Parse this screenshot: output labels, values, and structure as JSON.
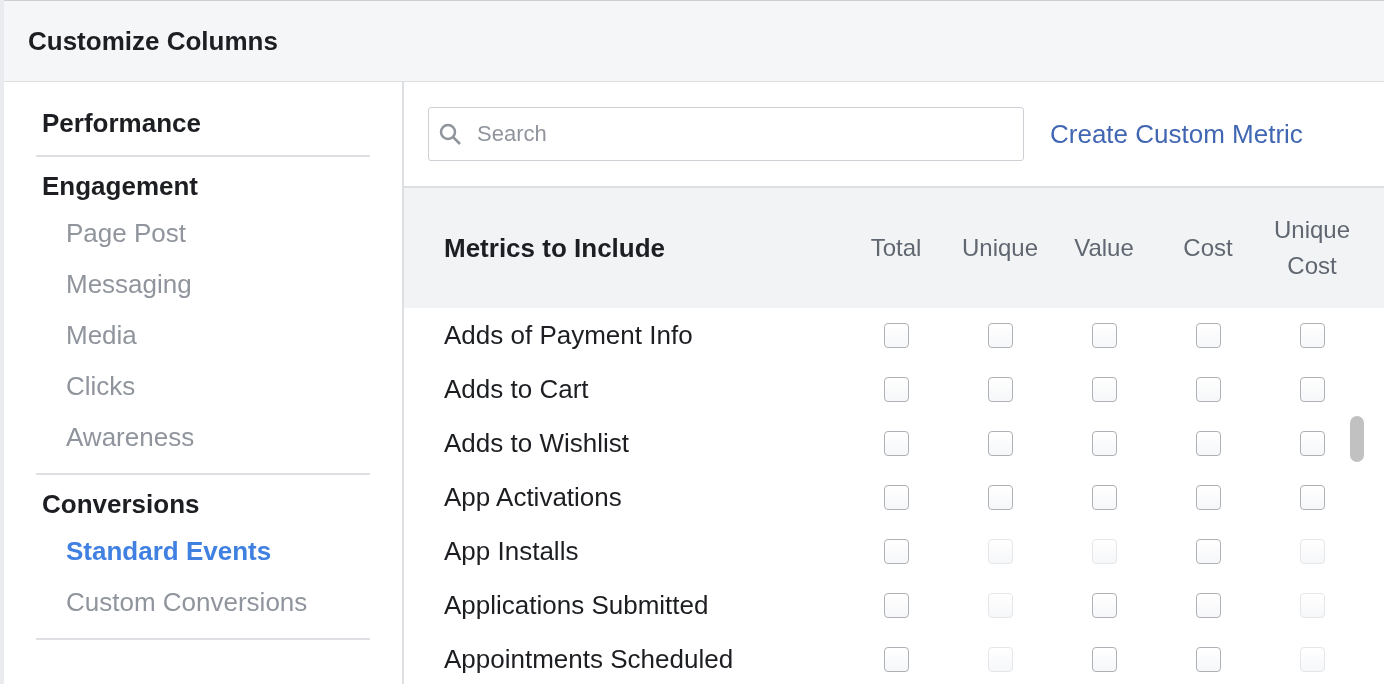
{
  "dialog": {
    "title": "Customize Columns"
  },
  "sidebar": {
    "groups": [
      {
        "title": "Performance"
      },
      {
        "title": "Engagement",
        "items": [
          {
            "label": "Page Post",
            "selected": false
          },
          {
            "label": "Messaging",
            "selected": false
          },
          {
            "label": "Media",
            "selected": false
          },
          {
            "label": "Clicks",
            "selected": false
          },
          {
            "label": "Awareness",
            "selected": false
          }
        ]
      },
      {
        "title": "Conversions",
        "items": [
          {
            "label": "Standard Events",
            "selected": true
          },
          {
            "label": "Custom Conversions",
            "selected": false
          }
        ]
      }
    ]
  },
  "search": {
    "placeholder": "Search"
  },
  "create_link": "Create Custom Metric",
  "table": {
    "title": "Metrics to Include",
    "columns": [
      "Total",
      "Unique",
      "Value",
      "Cost",
      "Unique Cost"
    ],
    "rows": [
      {
        "label": "Adds of Payment Info",
        "cells": [
          {
            "checked": false,
            "disabled": false
          },
          {
            "checked": false,
            "disabled": false
          },
          {
            "checked": false,
            "disabled": false
          },
          {
            "checked": false,
            "disabled": false
          },
          {
            "checked": false,
            "disabled": false
          }
        ]
      },
      {
        "label": "Adds to Cart",
        "cells": [
          {
            "checked": false,
            "disabled": false
          },
          {
            "checked": false,
            "disabled": false
          },
          {
            "checked": false,
            "disabled": false
          },
          {
            "checked": false,
            "disabled": false
          },
          {
            "checked": false,
            "disabled": false
          }
        ]
      },
      {
        "label": "Adds to Wishlist",
        "cells": [
          {
            "checked": false,
            "disabled": false
          },
          {
            "checked": false,
            "disabled": false
          },
          {
            "checked": false,
            "disabled": false
          },
          {
            "checked": false,
            "disabled": false
          },
          {
            "checked": false,
            "disabled": false
          }
        ]
      },
      {
        "label": "App Activations",
        "cells": [
          {
            "checked": false,
            "disabled": false
          },
          {
            "checked": false,
            "disabled": false
          },
          {
            "checked": false,
            "disabled": false
          },
          {
            "checked": false,
            "disabled": false
          },
          {
            "checked": false,
            "disabled": false
          }
        ]
      },
      {
        "label": "App Installs",
        "cells": [
          {
            "checked": false,
            "disabled": false
          },
          {
            "checked": false,
            "disabled": true
          },
          {
            "checked": false,
            "disabled": true
          },
          {
            "checked": false,
            "disabled": false
          },
          {
            "checked": false,
            "disabled": true
          }
        ]
      },
      {
        "label": "Applications Submitted",
        "cells": [
          {
            "checked": false,
            "disabled": false
          },
          {
            "checked": false,
            "disabled": true
          },
          {
            "checked": false,
            "disabled": false
          },
          {
            "checked": false,
            "disabled": false
          },
          {
            "checked": false,
            "disabled": true
          }
        ]
      },
      {
        "label": "Appointments Scheduled",
        "cells": [
          {
            "checked": false,
            "disabled": false
          },
          {
            "checked": false,
            "disabled": true
          },
          {
            "checked": false,
            "disabled": false
          },
          {
            "checked": false,
            "disabled": false
          },
          {
            "checked": false,
            "disabled": true
          }
        ]
      }
    ]
  }
}
